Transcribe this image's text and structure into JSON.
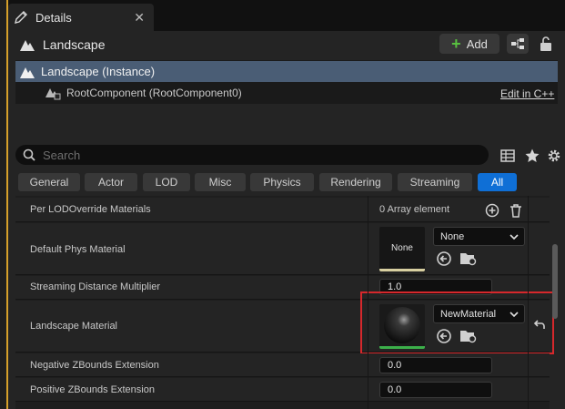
{
  "tab": {
    "title": "Details"
  },
  "header": {
    "title": "Landscape",
    "add_label": "Add"
  },
  "tree": {
    "selected": "Landscape (Instance)",
    "child": "RootComponent (RootComponent0)",
    "edit_link": "Edit in C++"
  },
  "search": {
    "placeholder": "Search"
  },
  "categories": [
    "General",
    "Actor",
    "LOD",
    "Misc",
    "Physics",
    "Rendering",
    "Streaming",
    "All"
  ],
  "active_category": "All",
  "properties": {
    "per_lod": {
      "name": "Per LODOverride Materials",
      "value": "0 Array element"
    },
    "phys": {
      "name": "Default Phys Material",
      "thumb_label": "None",
      "combo": "None"
    },
    "streaming": {
      "name": "Streaming Distance Multiplier",
      "value": "1.0"
    },
    "material": {
      "name": "Landscape Material",
      "combo": "NewMaterial"
    },
    "neg_z": {
      "name": "Negative ZBounds Extension",
      "value": "0.0"
    },
    "pos_z": {
      "name": "Positive ZBounds Extension",
      "value": "0.0"
    }
  },
  "colors": {
    "accent": "#0f6fd6",
    "selection": "#4a5d75",
    "highlight": "#d6282c",
    "add_green": "#58c040"
  }
}
